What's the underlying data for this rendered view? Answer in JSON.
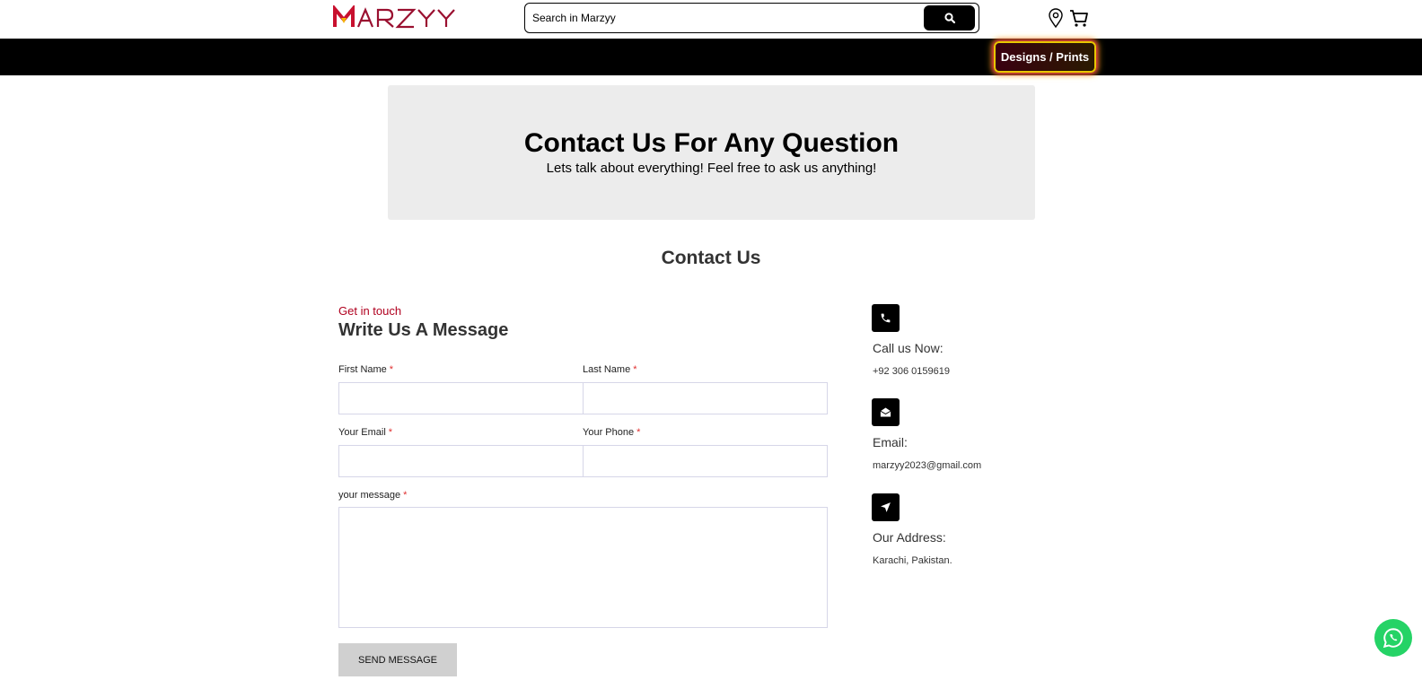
{
  "header": {
    "logo_text": "MARZYY",
    "search_placeholder": "Search in Marzyy",
    "icons": [
      "search-icon",
      "location-pin-icon",
      "cart-icon"
    ]
  },
  "nav": {
    "designs_label": "Designs / Prints"
  },
  "hero": {
    "title": "Contact Us For Any Question",
    "subtitle": "Lets talk about everything! Feel free to ask us anything!"
  },
  "section_title": "Contact Us",
  "form": {
    "kicker": "Get in touch",
    "title": "Write Us A Message",
    "required_mark": "*",
    "fields": {
      "first_name": "First Name",
      "last_name": "Last Name",
      "email": "Your Email",
      "phone": "Your Phone",
      "message": "your message"
    },
    "submit_label": "SEND MESSAGE"
  },
  "contact_info": {
    "phone": {
      "title": "Call us Now:",
      "value": "+92 306 0159619",
      "icon": "phone-icon"
    },
    "email": {
      "title": "Email:",
      "value": "marzyy2023@gmail.com",
      "icon": "envelope-open-icon"
    },
    "address": {
      "title": "Our Address:",
      "value": "Karachi, Pakistan.",
      "icon": "location-arrow-icon"
    }
  },
  "colors": {
    "brand_red": "#b0001f",
    "navbar_bg": "#000000",
    "hero_bg": "#ececec",
    "whatsapp_green": "#25d366",
    "neon_pink": "#ff1e5a",
    "neon_yellow": "#e8c700"
  }
}
